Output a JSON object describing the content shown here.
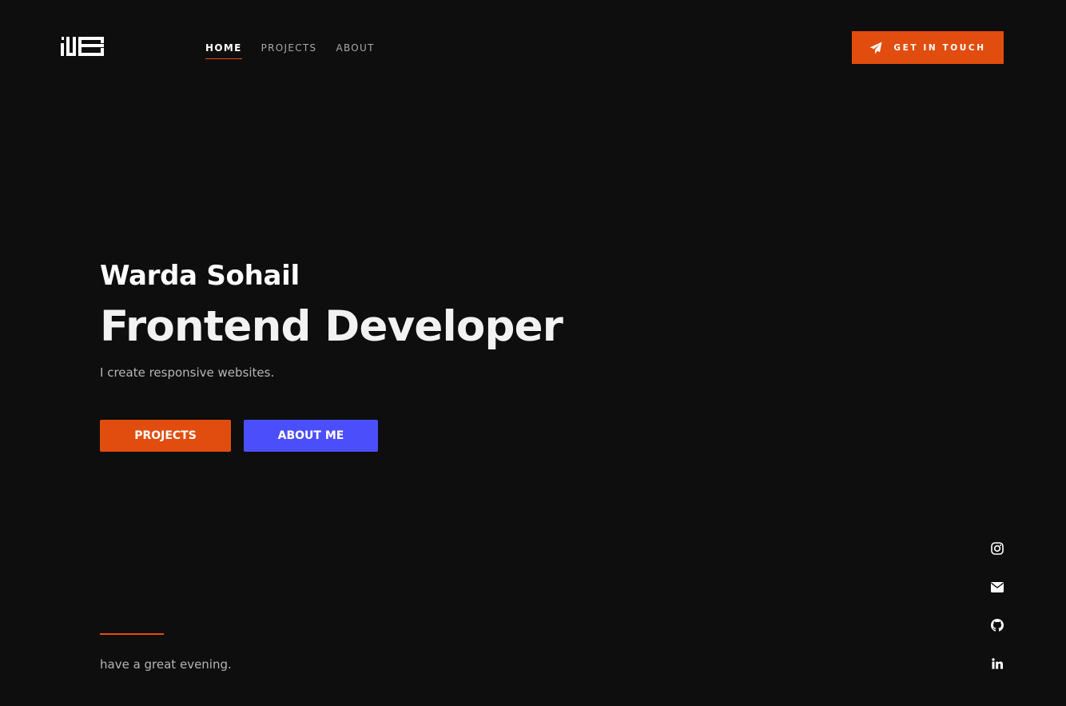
{
  "header": {
    "nav": [
      {
        "label": "HOME",
        "active": true
      },
      {
        "label": "PROJECTS",
        "active": false
      },
      {
        "label": "ABOUT",
        "active": false
      }
    ],
    "cta_label": "GET IN TOUCH",
    "cta_icon": "paper-plane-icon"
  },
  "hero": {
    "name": "Warda Sohail",
    "role": "Frontend Developer",
    "tagline": "I create responsive websites.",
    "buttons": {
      "projects": "PROJECTS",
      "about": "ABOUT ME"
    }
  },
  "footer": {
    "greeting": "have a great evening."
  },
  "social": [
    {
      "icon": "instagram-icon"
    },
    {
      "icon": "email-icon"
    },
    {
      "icon": "github-icon"
    },
    {
      "icon": "linkedin-icon"
    }
  ],
  "colors": {
    "background": "#0e0e0f",
    "accent_orange": "#e14d0e",
    "accent_blue": "#4b4ffb",
    "muted_text": "#b5b5b5"
  }
}
